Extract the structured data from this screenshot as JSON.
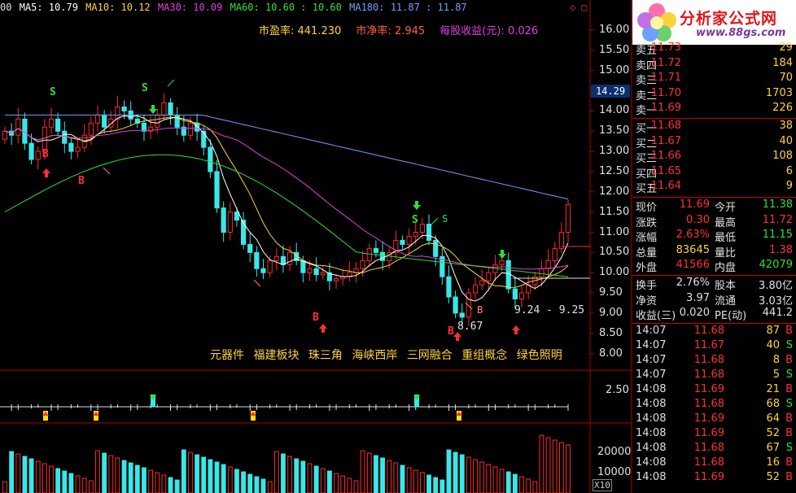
{
  "ma_bar": {
    "prefix": "00",
    "ma5": "MA5: 10.79",
    "ma10": "MA10: 10.12",
    "ma30": "MA30: 10.09",
    "ma60": "MA60: 10.60 : 10.60",
    "ma180": "MA180: 11.87 : 11.87",
    "colors": {
      "ma5": "#ffffff",
      "ma10": "#ffd23c",
      "ma30": "#e040e0",
      "ma60": "#30e030",
      "ma180": "#6fa0ff"
    }
  },
  "info": {
    "pe": "市盈率: 441.230",
    "pb": "市净率: 2.945",
    "eps": "每股收益(元): 0.026"
  },
  "concepts": [
    "元器件",
    "福建板块",
    "珠三角",
    "海峡西岸",
    "三网融合",
    "重组概念",
    "绿色照明"
  ],
  "price_axis": [
    "16.00",
    "15.50",
    "15.00",
    "14.50",
    "14.00",
    "13.50",
    "13.00",
    "12.50",
    "12.00",
    "11.50",
    "11.00",
    "10.50",
    "10.00",
    "9.50",
    "9.00",
    "8.50",
    "8.00"
  ],
  "price_tag": "14.29",
  "indicator_axis": "2.50",
  "volume_axis": [
    "20000",
    "10000"
  ],
  "volume_unit": "X10",
  "annotations": {
    "low_label": "8.67",
    "range_label": "9.24 - 9.25",
    "signals": [
      "S",
      "S",
      "S",
      "S",
      "B",
      "B",
      "B",
      "B",
      "B"
    ]
  },
  "logo": {
    "title": "分析家公式网",
    "url": "www.88gs.com"
  },
  "order_book": {
    "asks": [
      {
        "label": "卖五",
        "price": "11.73",
        "vol": "29"
      },
      {
        "label": "卖四",
        "price": "11.72",
        "vol": "184"
      },
      {
        "label": "卖三",
        "price": "11.71",
        "vol": "70"
      },
      {
        "label": "卖二",
        "price": "11.70",
        "vol": "1703"
      },
      {
        "label": "卖一",
        "price": "11.69",
        "vol": "226"
      }
    ],
    "bids": [
      {
        "label": "买一",
        "price": "11.68",
        "vol": "38"
      },
      {
        "label": "买二",
        "price": "11.67",
        "vol": "40"
      },
      {
        "label": "买三",
        "price": "11.66",
        "vol": "108"
      },
      {
        "label": "买四",
        "price": "11.65",
        "vol": "6"
      },
      {
        "label": "买五",
        "price": "11.64",
        "vol": "9"
      }
    ]
  },
  "quote": [
    {
      "k1": "现价",
      "v1": "11.69",
      "c1": "red",
      "k2": "今开",
      "v2": "11.38",
      "c2": "green"
    },
    {
      "k1": "涨跌",
      "v1": "0.30",
      "c1": "red",
      "k2": "最高",
      "v2": "11.72",
      "c2": "red"
    },
    {
      "k1": "涨幅",
      "v1": "2.63%",
      "c1": "red",
      "k2": "最低",
      "v2": "11.15",
      "c2": "green"
    },
    {
      "k1": "总量",
      "v1": "83645",
      "c1": "yellow",
      "k2": "量比",
      "v2": "1.38",
      "c2": "red"
    },
    {
      "k1": "外盘",
      "v1": "41566",
      "c1": "red",
      "k2": "内盘",
      "v2": "42079",
      "c2": "green"
    },
    {
      "k1": "换手",
      "v1": "2.76%",
      "c1": "white",
      "k2": "股本",
      "v2": "3.80亿",
      "c2": "white"
    },
    {
      "k1": "净资",
      "v1": "3.97",
      "c1": "white",
      "k2": "流通",
      "v2": "3.03亿",
      "c2": "white"
    },
    {
      "k1": "收益(三)",
      "v1": "0.020",
      "c1": "white",
      "k2": "PE(动)",
      "v2": "441.2",
      "c2": "white"
    }
  ],
  "ticks": [
    {
      "t": "14:07",
      "p": "11.68",
      "v": "87",
      "d": "B"
    },
    {
      "t": "14:07",
      "p": "11.67",
      "v": "40",
      "d": "S"
    },
    {
      "t": "14:07",
      "p": "11.68",
      "v": "8",
      "d": "B"
    },
    {
      "t": "14:07",
      "p": "11.68",
      "v": "5",
      "d": "S"
    },
    {
      "t": "14:08",
      "p": "11.69",
      "v": "21",
      "d": "B"
    },
    {
      "t": "14:08",
      "p": "11.68",
      "v": "68",
      "d": "S"
    },
    {
      "t": "14:08",
      "p": "11.69",
      "v": "64",
      "d": "B"
    },
    {
      "t": "14:08",
      "p": "11.69",
      "v": "52",
      "d": "B"
    },
    {
      "t": "14:08",
      "p": "11.68",
      "v": "67",
      "d": "S"
    },
    {
      "t": "14:08",
      "p": "11.68",
      "v": "16",
      "d": "B"
    },
    {
      "t": "14:08",
      "p": "11.69",
      "v": "52",
      "d": "B"
    }
  ]
}
